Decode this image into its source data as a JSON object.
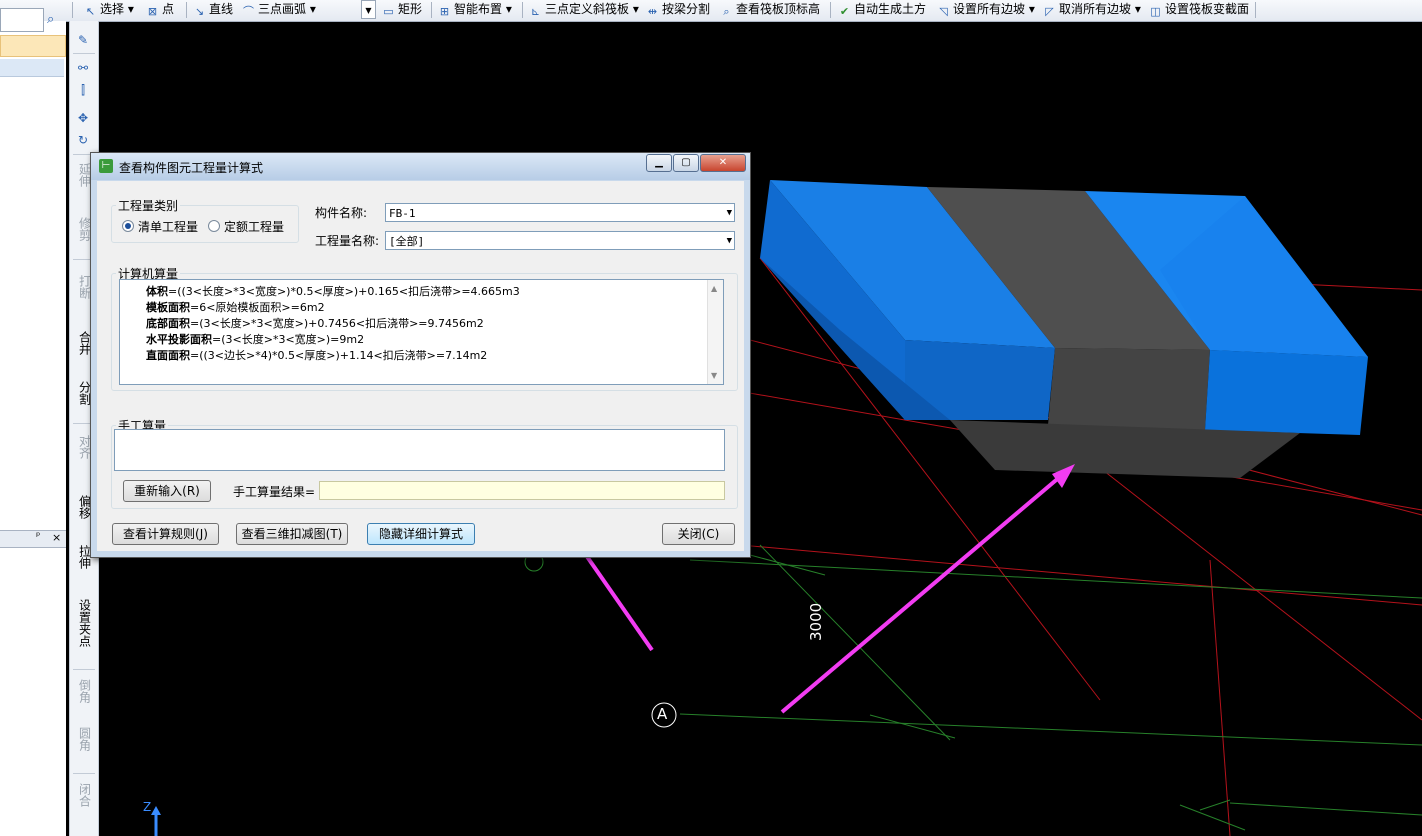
{
  "toolbar": {
    "select": "选择",
    "point": "点",
    "line": "直线",
    "arc": "三点画弧",
    "rect": "矩形",
    "smart_layout": "智能布置",
    "slope_slab": "三点定义斜筏板",
    "split_by_beam": "按梁分割",
    "view_top_elev": "查看筏板顶标高",
    "auto_earthwork": "自动生成土方",
    "set_all_slopes": "设置所有边坡",
    "cancel_all_slopes": "取消所有边坡",
    "set_section": "设置筏板变截面"
  },
  "vstrip": {
    "extend": "延伸",
    "trim": "修剪",
    "break": "打断",
    "merge": "合并",
    "split": "分割",
    "align": "对齐",
    "offset": "偏移",
    "stretch": "拉伸",
    "set_clamp": "设置夹点",
    "chamfer": "倒角",
    "fillet": "圆角",
    "close": "闭合"
  },
  "left_panel": {
    "pin": "ᵖ",
    "close": "×"
  },
  "dialog": {
    "title": "查看构件图元工程量计算式",
    "category_legend": "工程量类别",
    "radio_list": "清单工程量",
    "radio_quota": "定额工程量",
    "component_name_label": "构件名称:",
    "component_name_value": "FB-1",
    "quantity_name_label": "工程量名称:",
    "quantity_name_value": "[全部]",
    "computer_calc_legend": "计算机算量",
    "formulas": [
      {
        "name": "体积",
        "expr": "=((3<长度>*3<宽度>)*0.5<厚度>)+0.165<扣后浇带>=4.665m3"
      },
      {
        "name": "模板面积",
        "expr": "=6<原始模板面积>=6m2"
      },
      {
        "name": "底部面积",
        "expr": "=(3<长度>*3<宽度>)+0.7456<扣后浇带>=9.7456m2"
      },
      {
        "name": "水平投影面积",
        "expr": "=(3<长度>*3<宽度>)=9m2"
      },
      {
        "name": "直面面积",
        "expr": "=((3<边长>*4)*0.5<厚度>)+1.14<扣后浇带>=7.14m2"
      }
    ],
    "manual_legend": "手工算量",
    "reinput_btn": "重新输入(R)",
    "manual_result_label": "手工算量结果=",
    "view_rules_btn": "查看计算规则(J)",
    "view_3d_btn": "查看三维扣减图(T)",
    "hide_detail_btn": "隐藏详细计算式",
    "close_btn": "关闭(C)"
  },
  "viewport": {
    "dimension_label": "3000",
    "axis_a": "A",
    "axis_z": "Z"
  },
  "colors": {
    "slab_blue": "#1a86f0",
    "post_cast_strip": "#4a4a4a",
    "grid_red": "#c8141e",
    "grid_green": "#2f8f2f",
    "arrow_magenta": "#f23cf2"
  }
}
